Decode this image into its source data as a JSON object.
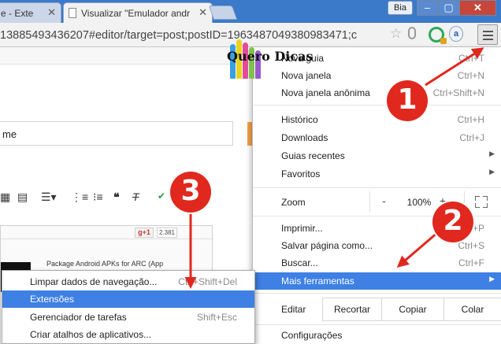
{
  "tabs": [
    {
      "title": "e - Exte",
      "active": false
    },
    {
      "title": "Visualizar \"Emulador andr",
      "active": true
    }
  ],
  "window": {
    "user_badge": "Bia"
  },
  "address_bar": {
    "url": "13885493436207#editor/target=post;postID=1963487049380983471;c"
  },
  "extensions": {
    "blue_label": "a"
  },
  "page": {
    "input_value": "me",
    "gplus_label": "g+1",
    "gplus_count": "2.381",
    "package_text": "Package Android APKs for ARC (App"
  },
  "logo": {
    "text": "Quero Dicas"
  },
  "menu": {
    "items_top": [
      {
        "label": "Nova guia",
        "shortcut": "Ctrl+T"
      },
      {
        "label": "Nova janela",
        "shortcut": "Ctrl+N"
      },
      {
        "label": "Nova janela anônima",
        "shortcut": "Ctrl+Shift+N"
      }
    ],
    "items_history": [
      {
        "label": "Histórico",
        "shortcut": "Ctrl+H",
        "submenu": false
      },
      {
        "label": "Downloads",
        "shortcut": "Ctrl+J",
        "submenu": false
      },
      {
        "label": "Guias recentes",
        "shortcut": "",
        "submenu": true
      },
      {
        "label": "Favoritos",
        "shortcut": "",
        "submenu": true
      }
    ],
    "zoom": {
      "label": "Zoom",
      "minus": "-",
      "value": "100%",
      "plus": "+"
    },
    "items_tools": [
      {
        "label": "Imprimir...",
        "shortcut": "Ctrl+P"
      },
      {
        "label": "Salvar página como...",
        "shortcut": "Ctrl+S"
      },
      {
        "label": "Buscar...",
        "shortcut": "Ctrl+F"
      },
      {
        "label": "Mais ferramentas",
        "shortcut": ""
      }
    ],
    "edit": {
      "label": "Editar",
      "cut": "Recortar",
      "copy": "Copiar",
      "paste": "Colar"
    },
    "settings_label": "Configurações"
  },
  "submenu": {
    "items": [
      {
        "label": "Limpar dados de navegação...",
        "shortcut": "Ctrl+Shift+Del"
      },
      {
        "label": "Extensões",
        "shortcut": ""
      },
      {
        "label": "Gerenciador de tarefas",
        "shortcut": "Shift+Esc"
      },
      {
        "label": "Criar atalhos de aplicativos...",
        "shortcut": ""
      }
    ]
  },
  "callouts": {
    "one": "1",
    "two": "2",
    "three": "3"
  },
  "colors": {
    "highlight": "#3e80e4",
    "callout": "#e0281f",
    "titlebar": "#3b79c9"
  }
}
